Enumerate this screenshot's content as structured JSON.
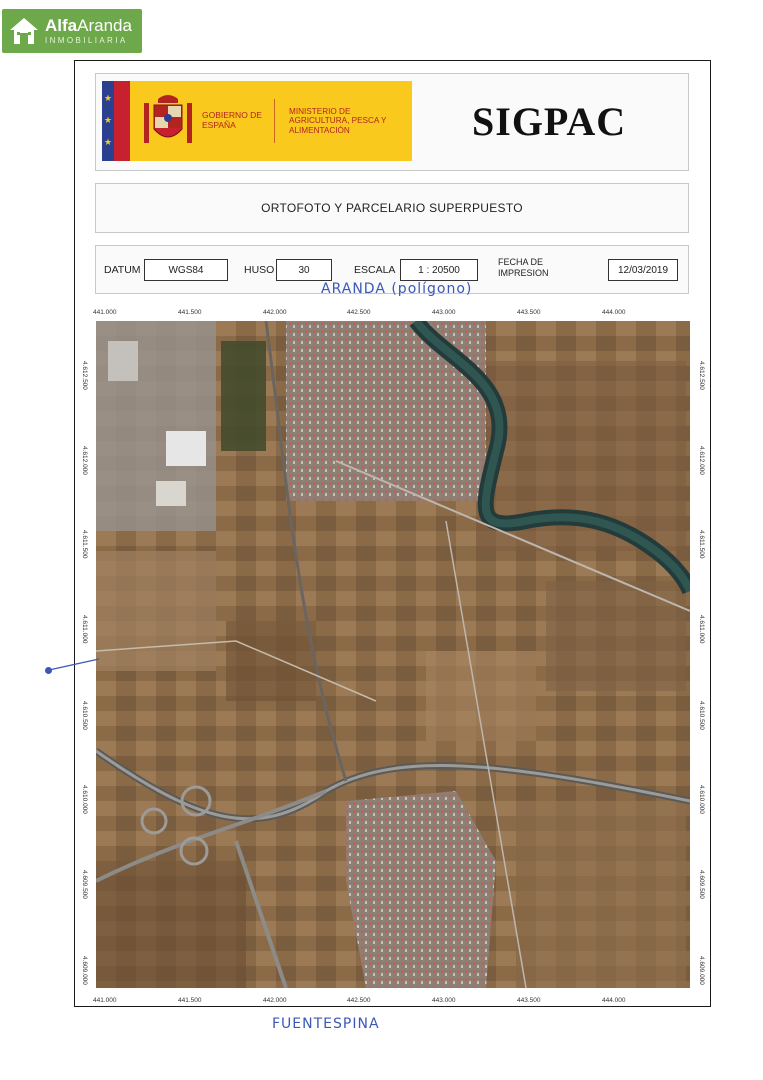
{
  "brand": {
    "name_part1": "Alfa",
    "name_part2": "Aranda",
    "subtitle": "INMOBILIARIA",
    "icon": "house-icon",
    "color": "#6da84a"
  },
  "header": {
    "gov_line": "GOBIERNO DE ESPAÑA",
    "ministry_line": "MINISTERIO DE AGRICULTURA, PESCA Y ALIMENTACIÓN",
    "system_title": "SIGPAC",
    "banner_color": "#f9c91d",
    "coat_of_arms_icon": "coat-of-arms-icon"
  },
  "document": {
    "title": "ORTOFOTO Y PARCELARIO SUPERPUESTO"
  },
  "info": {
    "datum_label": "DATUM",
    "datum_value": "WGS84",
    "huso_label": "HUSO",
    "huso_value": "30",
    "escala_label": "ESCALA",
    "escala_value": "1 : 20500",
    "fecha_label_1": "FECHA DE",
    "fecha_label_2": "IMPRESION",
    "fecha_value": "12/03/2019"
  },
  "annotations": {
    "top_note": "ARANDA (polígono)",
    "bottom_note": "FUENTESPINA",
    "ink_color": "#3a58b8"
  },
  "coordinates": {
    "x_top": [
      "441.000",
      "441.500",
      "442.000",
      "442.500",
      "443.000",
      "443.500",
      "444.000"
    ],
    "x_bottom": [
      "441.000",
      "441.500",
      "442.000",
      "442.500",
      "443.000",
      "443.500",
      "444.000"
    ],
    "y_left": [
      "4.612.500",
      "4.612.000",
      "4.611.500",
      "4.611.000",
      "4.610.500",
      "4.610.000",
      "4.609.500",
      "4.609.000"
    ],
    "y_right": [
      "4.612.500",
      "4.612.000",
      "4.611.500",
      "4.611.000",
      "4.610.500",
      "4.610.000",
      "4.609.500",
      "4.609.000"
    ]
  }
}
